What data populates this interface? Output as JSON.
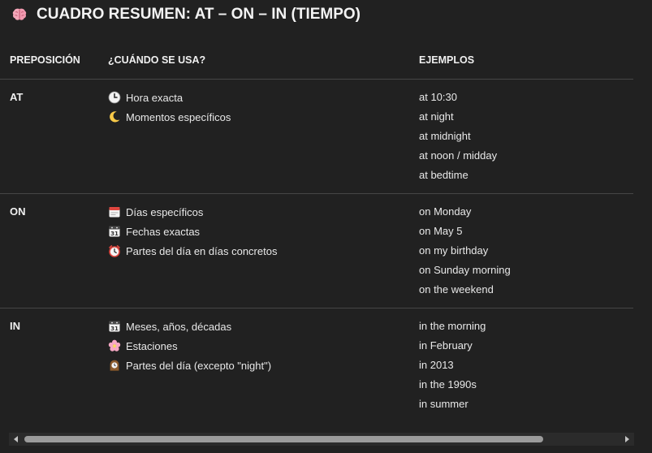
{
  "title": "CUADRO RESUMEN: AT – ON – IN (TIEMPO)",
  "title_icon": "brain-icon",
  "headers": {
    "preposicion": "PREPOSICIÓN",
    "cuando": "¿CUÁNDO SE USA?",
    "ejemplos": "EJEMPLOS"
  },
  "rows": [
    {
      "prep": "AT",
      "usages": [
        {
          "icon": "clock-icon",
          "label": "Hora exacta"
        },
        {
          "icon": "crescent-moon-icon",
          "label": "Momentos específicos"
        }
      ],
      "examples": [
        "at 10:30",
        "at night",
        "at midnight",
        "at noon / midday",
        "at bedtime"
      ]
    },
    {
      "prep": "ON",
      "usages": [
        {
          "icon": "tear-off-calendar-icon",
          "label": "Días específicos"
        },
        {
          "icon": "calendar-icon",
          "label": "Fechas exactas"
        },
        {
          "icon": "alarm-clock-icon",
          "label": "Partes del día en días concretos"
        }
      ],
      "examples": [
        "on Monday",
        "on May 5",
        "on my birthday",
        "on Sunday morning",
        "on the weekend"
      ]
    },
    {
      "prep": "IN",
      "usages": [
        {
          "icon": "calendar-icon",
          "label": "Meses, años, décadas"
        },
        {
          "icon": "cherry-blossom-icon",
          "label": "Estaciones"
        },
        {
          "icon": "mantelpiece-clock-icon",
          "label": "Partes del día (excepto \"night\")"
        }
      ],
      "examples": [
        "in the morning",
        "in February",
        "in 2013",
        "in the 1990s",
        "in summer"
      ]
    }
  ],
  "colors": {
    "background": "#212121",
    "text": "#ececec",
    "divider": "#464646",
    "scroll_thumb": "#9b9b9b"
  }
}
